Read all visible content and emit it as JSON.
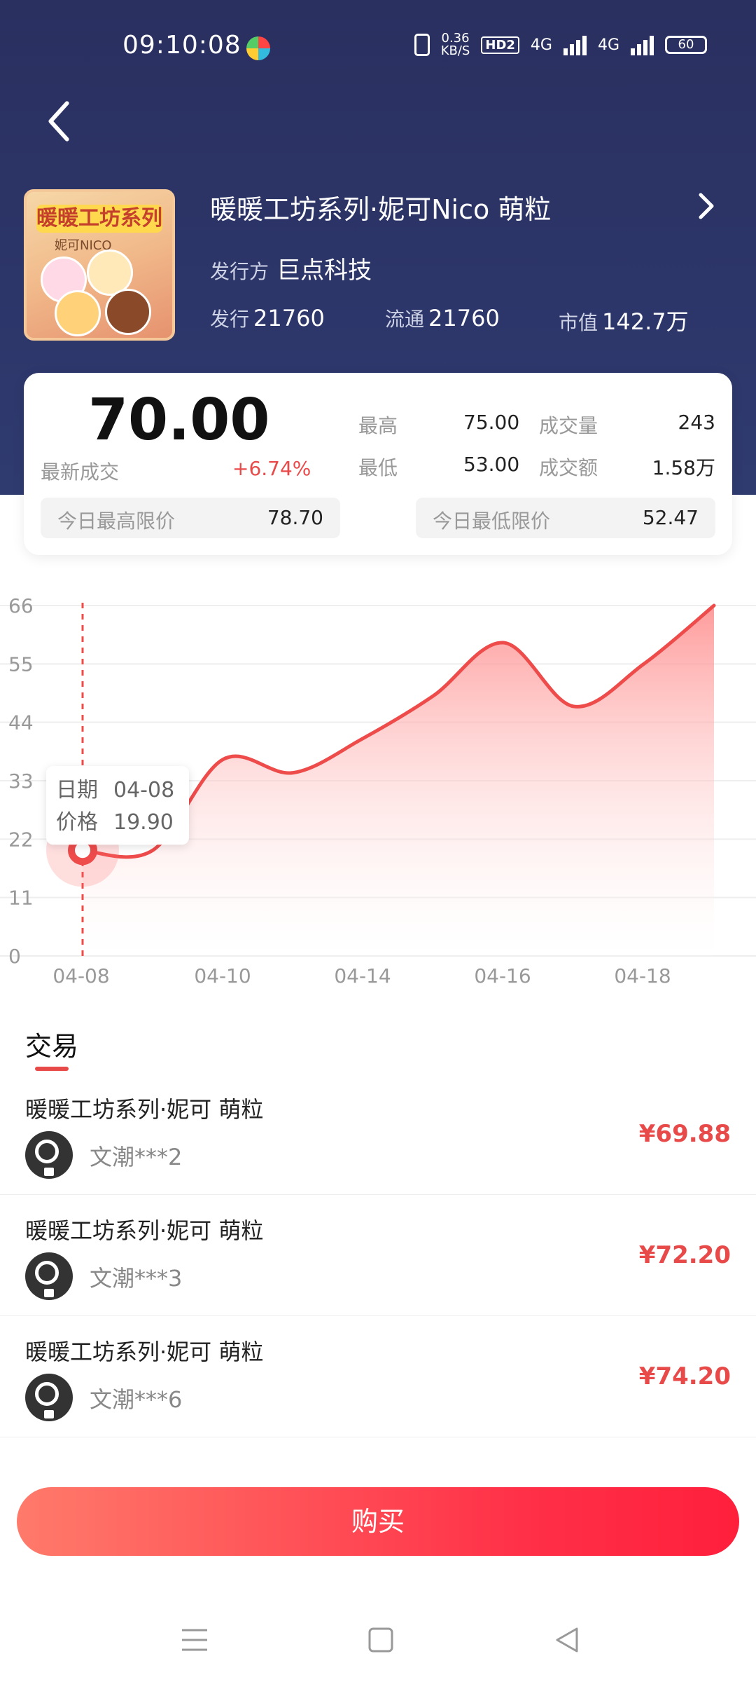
{
  "status_bar": {
    "time": "09:10:08",
    "net_speed_value": "0.36",
    "net_speed_unit": "KB/S",
    "hd_badge": "HD2",
    "signal1_label": "4G",
    "signal2_label": "4G",
    "battery": "60"
  },
  "product": {
    "thumb_title": "暖暖工坊系列",
    "thumb_sub": "妮可NICO",
    "title": "暖暖工坊系列·妮可Nico 萌粒",
    "issuer_label": "发行方",
    "issuer_name": "巨点科技",
    "stats": [
      {
        "label": "发行",
        "value": "21760"
      },
      {
        "label": "流通",
        "value": "21760"
      },
      {
        "label": "市值",
        "value": "142.7万"
      }
    ]
  },
  "price_card": {
    "last_price": "70.00",
    "last_price_label": "最新成交",
    "change_percent": "+6.74%",
    "high_label": "最高",
    "high_value": "75.00",
    "volume_label": "成交量",
    "volume_value": "243",
    "low_label": "最低",
    "low_value": "53.00",
    "turnover_label": "成交额",
    "turnover_value": "1.58万",
    "limit_high_label": "今日最高限价",
    "limit_high_value": "78.70",
    "limit_low_label": "今日最低限价",
    "limit_low_value": "52.47"
  },
  "chart_data": {
    "type": "area",
    "y_ticks": [
      "66",
      "55",
      "44",
      "33",
      "22",
      "11",
      "0"
    ],
    "ylim": [
      0,
      66
    ],
    "x_ticks": [
      "04-08",
      "04-10",
      "04-14",
      "04-16",
      "04-18"
    ],
    "series": [
      {
        "points": [
          {
            "x": 0.0,
            "y": 19.9
          },
          {
            "x": 1.0,
            "y": 19.9
          },
          {
            "x": 2.0,
            "y": 37
          },
          {
            "x": 3.0,
            "y": 34.5
          },
          {
            "x": 4.0,
            "y": 41
          },
          {
            "x": 5.0,
            "y": 49
          },
          {
            "x": 6.0,
            "y": 59
          },
          {
            "x": 7.0,
            "y": 47
          },
          {
            "x": 8.0,
            "y": 55
          },
          {
            "x": 9.0,
            "y": 66
          }
        ]
      }
    ],
    "tooltip": {
      "date_label": "日期",
      "date_value": "04-08",
      "price_label": "价格",
      "price_value": "19.90"
    },
    "colors": {
      "line": "#ee4b4b",
      "area_top": "#ff8a8a"
    }
  },
  "trade": {
    "section_title": "交易",
    "items": [
      {
        "name": "暖暖工坊系列·妮可 萌粒",
        "user": "文潮***2",
        "price": "¥69.88"
      },
      {
        "name": "暖暖工坊系列·妮可 萌粒",
        "user": "文潮***3",
        "price": "¥72.20"
      },
      {
        "name": "暖暖工坊系列·妮可 萌粒",
        "user": "文潮***6",
        "price": "¥74.20"
      }
    ]
  },
  "buy_button": {
    "label": "购买"
  }
}
